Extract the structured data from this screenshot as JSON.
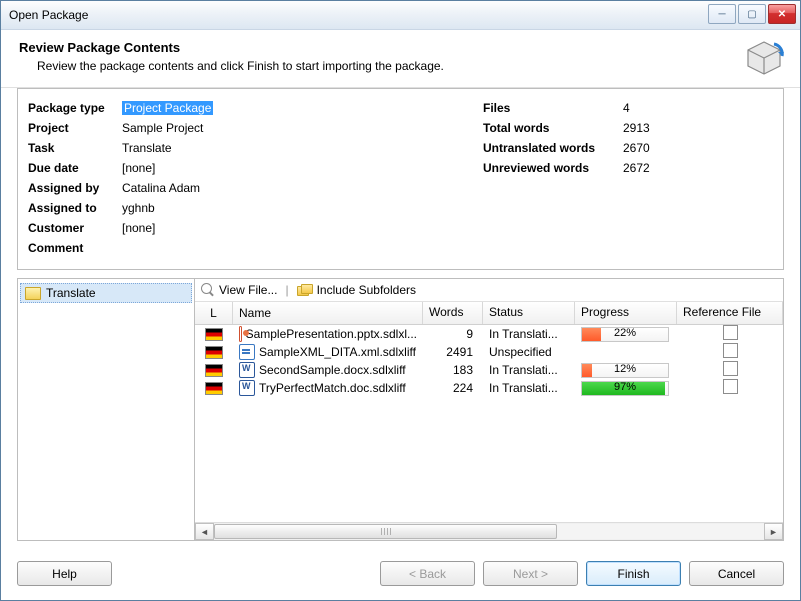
{
  "window": {
    "title": "Open Package"
  },
  "header": {
    "title": "Review Package Contents",
    "subtitle": "Review the package contents and click Finish to start importing the package."
  },
  "info_left": [
    {
      "label": "Package type",
      "value": "Project Package",
      "highlight": true
    },
    {
      "label": "Project",
      "value": "Sample Project"
    },
    {
      "label": "Task",
      "value": "Translate"
    },
    {
      "label": "Due date",
      "value": "[none]"
    },
    {
      "label": "Assigned by",
      "value": "Catalina Adam"
    },
    {
      "label": "Assigned to",
      "value": "yghnb"
    },
    {
      "label": "Customer",
      "value": "[none]"
    },
    {
      "label": "Comment",
      "value": ""
    }
  ],
  "info_right": [
    {
      "label": "Files",
      "value": "4"
    },
    {
      "label": "Total words",
      "value": "2913"
    },
    {
      "label": "Untranslated words",
      "value": "2670"
    },
    {
      "label": "Unreviewed words",
      "value": "2672"
    }
  ],
  "tree": {
    "item": "Translate"
  },
  "toolbar": {
    "view_file": "View File...",
    "include_subfolders": "Include Subfolders"
  },
  "columns": {
    "l": "L",
    "name": "Name",
    "words": "Words",
    "status": "Status",
    "progress": "Progress",
    "reference": "Reference File"
  },
  "rows": [
    {
      "icon": "ppt",
      "name": "SamplePresentation.pptx.sdlxl...",
      "words": "9",
      "status": "In Translati...",
      "progress": 22,
      "color": "red"
    },
    {
      "icon": "xml",
      "name": "SampleXML_DITA.xml.sdlxliff",
      "words": "2491",
      "status": "Unspecified",
      "progress": null,
      "color": ""
    },
    {
      "icon": "word",
      "name": "SecondSample.docx.sdlxliff",
      "words": "183",
      "status": "In Translati...",
      "progress": 12,
      "color": "red"
    },
    {
      "icon": "word",
      "name": "TryPerfectMatch.doc.sdlxliff",
      "words": "224",
      "status": "In Translati...",
      "progress": 97,
      "color": "green"
    }
  ],
  "buttons": {
    "help": "Help",
    "back": "< Back",
    "next": "Next >",
    "finish": "Finish",
    "cancel": "Cancel"
  }
}
